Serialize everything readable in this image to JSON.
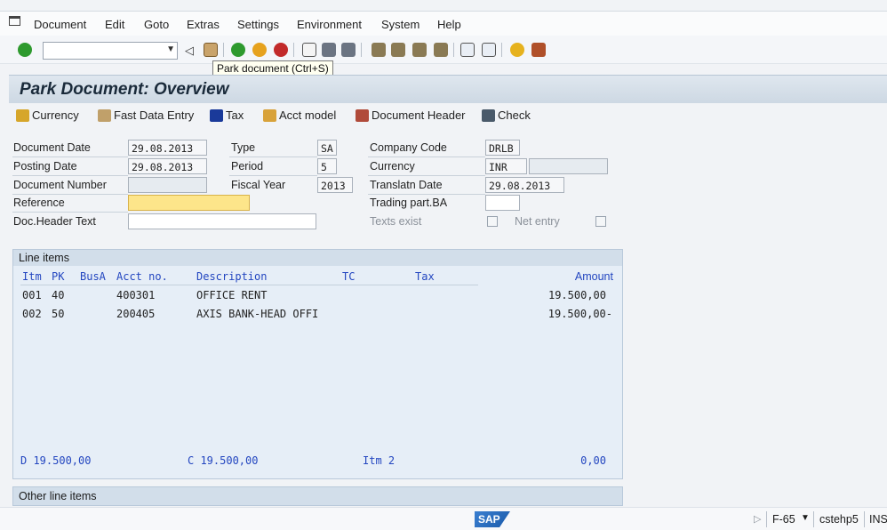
{
  "menu": {
    "items": [
      "Document",
      "Edit",
      "Goto",
      "Extras",
      "Settings",
      "Environment",
      "System",
      "Help"
    ],
    "underlines": [
      "D",
      "E",
      "G",
      "a",
      "S",
      "v",
      "y",
      "H"
    ]
  },
  "toolbar": {
    "tooltip": "Park document  (Ctrl+S)"
  },
  "screen": {
    "title": "Park Document: Overview"
  },
  "app_toolbar": {
    "currency": "Currency",
    "fast_data_entry": "Fast Data Entry",
    "tax": "Tax",
    "acct_model": "Acct model",
    "document_header": "Document Header",
    "check": "Check"
  },
  "header": {
    "document_date_label": "Document Date",
    "document_date": "29.08.2013",
    "posting_date_label": "Posting Date",
    "posting_date": "29.08.2013",
    "document_number_label": "Document Number",
    "document_number": "",
    "reference_label": "Reference",
    "reference": "",
    "doc_header_text_label": "Doc.Header Text",
    "doc_header_text": "",
    "type_label": "Type",
    "type": "SA",
    "period_label": "Period",
    "period": "5",
    "fiscal_year_label": "Fiscal Year",
    "fiscal_year": "2013",
    "company_code_label": "Company Code",
    "company_code": "DRLB",
    "currency_label": "Currency",
    "currency": "INR",
    "currency_extra": "",
    "translatn_date_label": "Translatn Date",
    "translatn_date": "29.08.2013",
    "trading_part_label": "Trading part.BA",
    "trading_part": "",
    "texts_exist_label": "Texts exist",
    "net_entry_label": "Net entry"
  },
  "line_items": {
    "title": "Line items",
    "columns": {
      "itm": "Itm",
      "pk": "PK",
      "busa": "BusA",
      "acct": "Acct no.",
      "desc": "Description",
      "tc": "TC",
      "tax": "Tax",
      "amount": "Amount"
    },
    "rows": [
      {
        "itm": "001",
        "pk": "40",
        "acct": "400301",
        "desc": "OFFICE RENT",
        "amount": "19.500,00"
      },
      {
        "itm": "002",
        "pk": "50",
        "acct": "200405",
        "desc": "AXIS BANK-HEAD OFFI",
        "amount": "19.500,00-"
      }
    ],
    "footer": {
      "debit": "D 19.500,00",
      "credit": "C 19.500,00",
      "items": "Itm 2",
      "balance": "0,00"
    }
  },
  "other_line_items": {
    "title": "Other line items"
  },
  "status": {
    "logo": "SAP",
    "tcode": "F-65",
    "server": "cstehp5",
    "mode": "INS"
  }
}
